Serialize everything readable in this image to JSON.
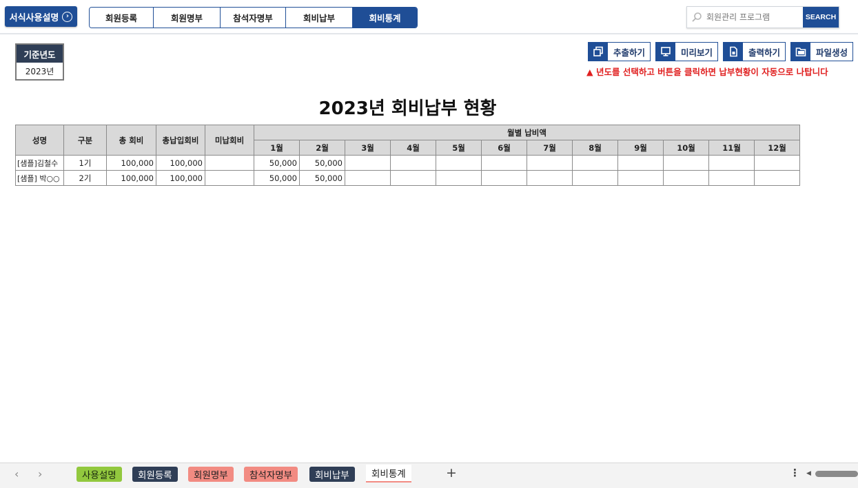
{
  "header": {
    "guide_label": "서식사용설명",
    "tabs": [
      {
        "label": "회원등록"
      },
      {
        "label": "회원명부"
      },
      {
        "label": "참석자명부"
      },
      {
        "label": "회비납부"
      },
      {
        "label": "회비통계"
      }
    ],
    "search": {
      "placeholder": "회원관리 프로그램",
      "button": "SEARCH"
    }
  },
  "year_box": {
    "label": "기준년도",
    "value": "2023년"
  },
  "actions": [
    {
      "label": "추출하기",
      "icon": "copy-icon"
    },
    {
      "label": "미리보기",
      "icon": "monitor-icon"
    },
    {
      "label": "출력하기",
      "icon": "print-icon"
    },
    {
      "label": "파일생성",
      "icon": "folder-icon"
    }
  ],
  "notice": "▲ 년도를 선택하고 버튼을 클릭하면 납부현황이 자동으로 나탑니다",
  "title": "2023년 회비납부 현황",
  "table": {
    "headers": {
      "name": "성명",
      "type": "구분",
      "total_fee": "총 회비",
      "total_paid": "총납입회비",
      "unpaid": "미납회비",
      "monthly": "월별 납비액"
    },
    "months": [
      "1월",
      "2월",
      "3월",
      "4월",
      "5월",
      "6월",
      "7월",
      "8월",
      "9월",
      "10월",
      "11월",
      "12월"
    ],
    "rows": [
      {
        "name": "[샘플]김철수",
        "type": "1기",
        "total_fee": "100,000",
        "total_paid": "100,000",
        "unpaid": "",
        "monthly": [
          "50,000",
          "50,000",
          "",
          "",
          "",
          "",
          "",
          "",
          "",
          "",
          "",
          ""
        ]
      },
      {
        "name": "[샘플] 박○○",
        "type": "2기",
        "total_fee": "100,000",
        "total_paid": "100,000",
        "unpaid": "",
        "monthly": [
          "50,000",
          "50,000",
          "",
          "",
          "",
          "",
          "",
          "",
          "",
          "",
          "",
          ""
        ]
      }
    ]
  },
  "sheets": {
    "prev": "‹",
    "next": "›",
    "tabs": [
      {
        "label": "사용설명",
        "color": "#92c83e",
        "text_color": "#1b2a10"
      },
      {
        "label": "회원등록",
        "color": "#2f3e56",
        "text_color": "#ffffff"
      },
      {
        "label": "회원명부",
        "color": "#f28b82",
        "text_color": "#222222"
      },
      {
        "label": "참석자명부",
        "color": "#f28b82",
        "text_color": "#222222"
      },
      {
        "label": "회비납부",
        "color": "#2f3e56",
        "text_color": "#ffffff"
      },
      {
        "label": "회비통계",
        "color": "#ffffff",
        "text_color": "#222222"
      }
    ],
    "add": "+",
    "more": "⋮"
  }
}
